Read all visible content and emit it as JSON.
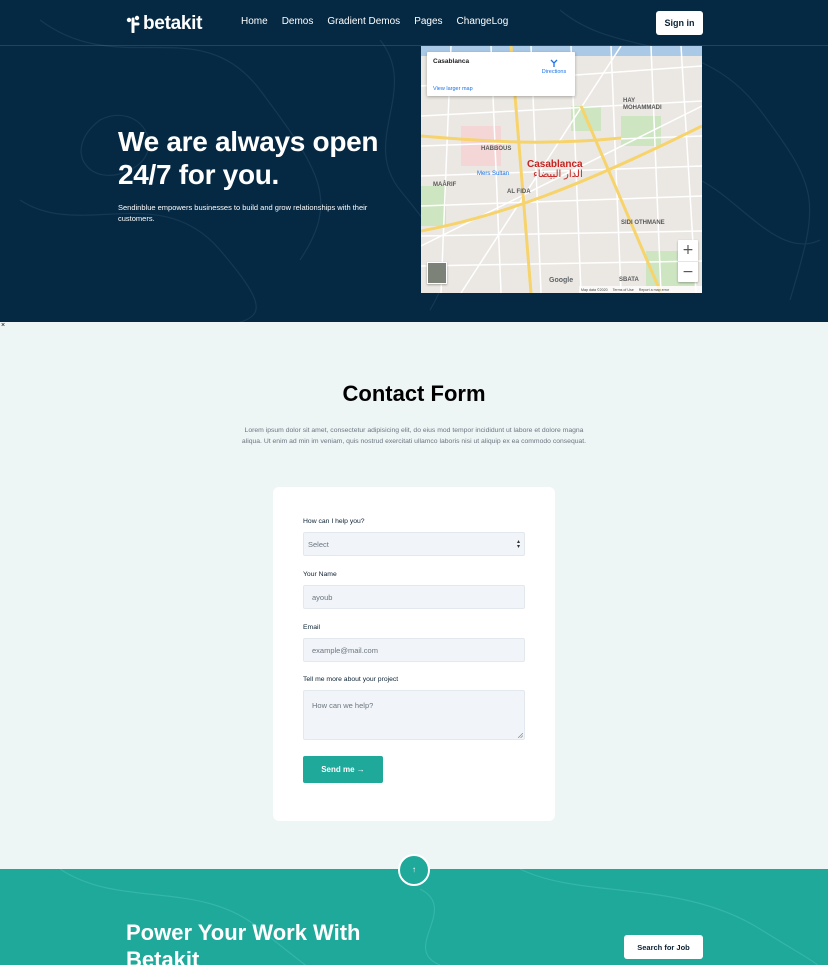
{
  "brand": {
    "logo_text": "betakit"
  },
  "nav": {
    "links": [
      "Home",
      "Demos",
      "Gradient Demos",
      "Pages",
      "ChangeLog"
    ],
    "signin_label": "Sign in"
  },
  "hero": {
    "title": "We are always open 24/7 for you.",
    "subtitle": "Sendinblue empowers businesses to build and grow relationships with their customers."
  },
  "map": {
    "place_title": "Casablanca",
    "directions_label": "Directions",
    "larger_map_label": "View larger map",
    "city_label": "Casablanca",
    "city_label_ar": "الدار البيضاء",
    "districts": [
      "HABBOUS",
      "MAÂRIF",
      "AL FIDA",
      "SIDI OTHMANE",
      "HAY MOHAMMADI",
      "SBATA",
      "Mers Sultan"
    ],
    "google_label": "Google",
    "footer": [
      "Map data ©2020",
      "Terms of Use",
      "Report a map error"
    ],
    "zoom_in": "+",
    "zoom_out": "−"
  },
  "close_label": "×",
  "contact": {
    "title": "Contact Form",
    "description": "Lorem ipsum dolor sit amet, consectetur adipisicing elit, do eius mod tempor incididunt ut labore et dolore magna aliqua. Ut enim ad min im veniam, quis nostrud exercitati ullamco laboris nisi ut aliquip ex ea commodo consequat."
  },
  "form": {
    "help_label": "How can I help you?",
    "help_value": "Select",
    "name_label": "Your Name",
    "name_placeholder": "ayoub",
    "email_label": "Email",
    "email_placeholder": "example@mail.com",
    "project_label": "Tell me more about your project",
    "project_placeholder": "How can we help?",
    "send_label": "Send me →"
  },
  "cta": {
    "title": "Power Your Work With Betakit",
    "button_label": "Search for Job",
    "scroll_top": "↑"
  },
  "colors": {
    "navy": "#062943",
    "teal": "#1ea99a",
    "light_bg": "#eef5f5"
  }
}
